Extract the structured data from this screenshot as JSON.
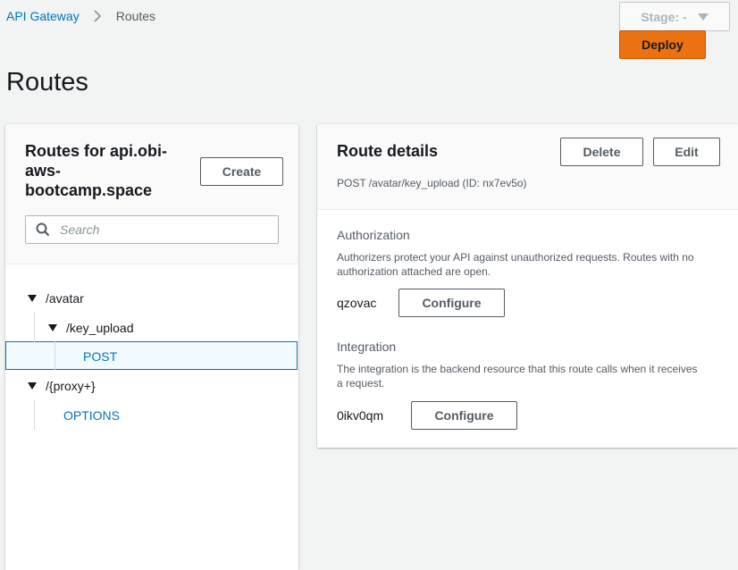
{
  "breadcrumb": {
    "parent": "API Gateway",
    "current": "Routes"
  },
  "stage": {
    "label": "Stage: -"
  },
  "deploy": {
    "label": "Deploy"
  },
  "page": {
    "title": "Routes"
  },
  "routes_panel": {
    "title": "Routes for api.obi-aws-bootcamp.space",
    "title_lines": [
      "Routes for api.obi-",
      "aws-",
      "bootcamp.space"
    ],
    "create_label": "Create",
    "search_placeholder": "Search",
    "tree": {
      "avatar": "/avatar",
      "key_upload": "/key_upload",
      "post": "POST",
      "proxy": "/{proxy+}",
      "options": "OPTIONS"
    }
  },
  "details": {
    "title": "Route details",
    "delete_label": "Delete",
    "edit_label": "Edit",
    "route_summary": "POST /avatar/key_upload (ID: nx7ev5o)",
    "authorization": {
      "heading": "Authorization",
      "description": "Authorizers protect your API against unauthorized requests. Routes with no authorization attached are open.",
      "authorizer_id": "qzovac",
      "configure_label": "Configure"
    },
    "integration": {
      "heading": "Integration",
      "description": "The integration is the backend resource that this route calls when it receives a request.",
      "integration_id": "0ikv0qm",
      "configure_label": "Configure"
    }
  },
  "colors": {
    "link": "#0073bb",
    "deploy": "#ec7211",
    "background": "#f2f3f3"
  }
}
